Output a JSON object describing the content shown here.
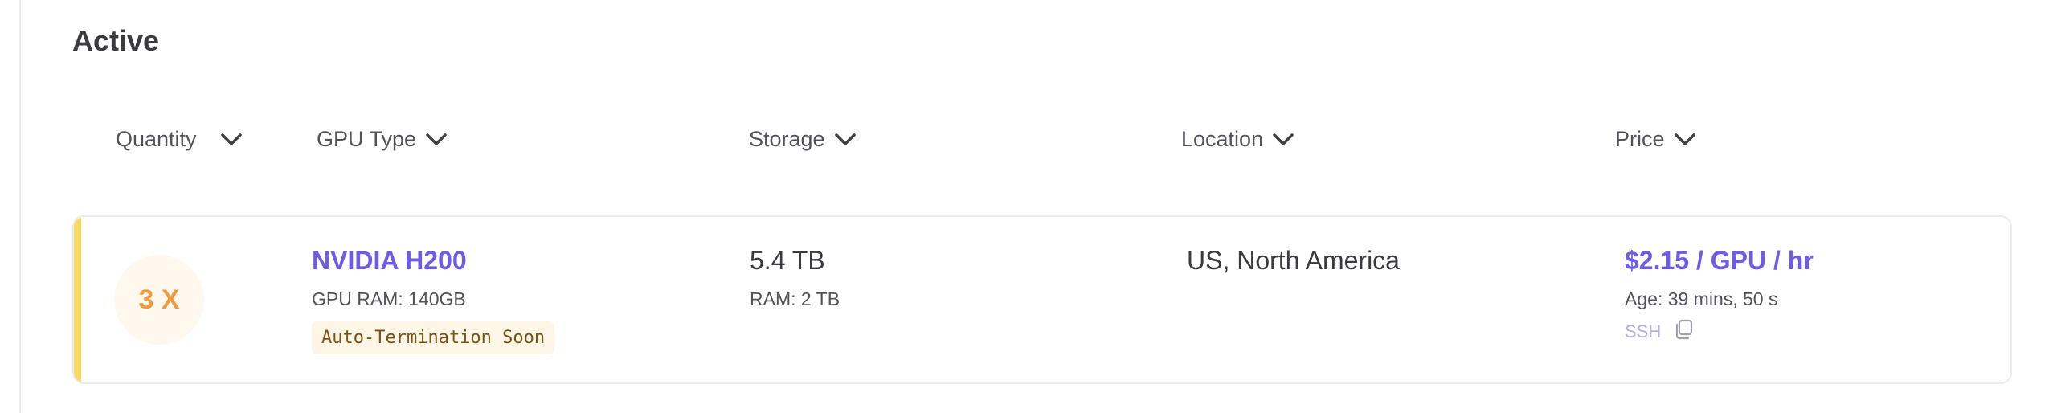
{
  "section": {
    "title": "Active"
  },
  "columns": [
    {
      "label": "Quantity",
      "icon": "chevron-down-icon"
    },
    {
      "label": "GPU Type",
      "icon": "chevron-down-icon"
    },
    {
      "label": "Storage",
      "icon": "chevron-down-icon"
    },
    {
      "label": "Location",
      "icon": "chevron-down-icon"
    },
    {
      "label": "Price",
      "icon": "chevron-down-icon"
    }
  ],
  "rows": [
    {
      "quantity": "3 X",
      "gpu_type": "NVIDIA H200",
      "gpu_ram": "GPU RAM: 140GB",
      "status_badge": "Auto-Termination Soon",
      "storage": "5.4 TB",
      "ram": "RAM: 2 TB",
      "location": "US, North America",
      "price": "$2.15 / GPU / hr",
      "age": "Age: 39 mins, 50 s",
      "ssh_label": "SSH",
      "ssh_icon": "copy-icon"
    }
  ],
  "colors": {
    "accent_purple": "#6c5ce7",
    "quantity_orange": "#f09a3e",
    "row_accent_yellow": "#f8dc62",
    "badge_bg": "#fdf5e6",
    "ssh_muted": "#b4aeea"
  }
}
